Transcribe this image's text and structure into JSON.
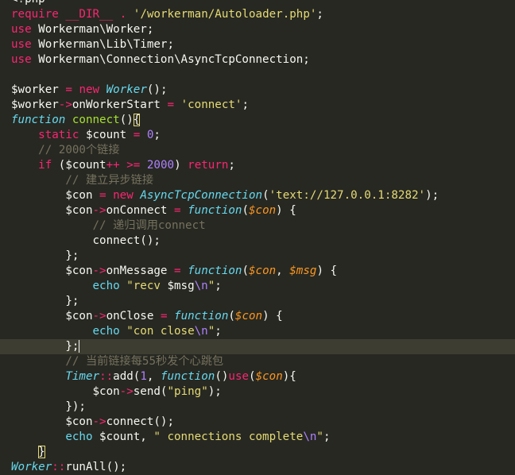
{
  "editor": {
    "theme": {
      "background": "#272822",
      "current_line": "#3e3d32",
      "keyword": "#f92672",
      "storage": "#66d9ef",
      "function_name": "#a6e22e",
      "string": "#e6db74",
      "number": "#ae81ff",
      "parameter": "#fd971f",
      "comment": "#75715e",
      "text": "#f8f8f2"
    },
    "highlighted_line": 23,
    "lines": [
      [
        [
          "text",
          "<?php"
        ]
      ],
      [
        [
          "kw",
          "require"
        ],
        [
          "text",
          " "
        ],
        [
          "kw",
          "__DIR__"
        ],
        [
          "text",
          " "
        ],
        [
          "kw",
          "."
        ],
        [
          "text",
          " "
        ],
        [
          "str",
          "'/workerman/Autoloader.php'"
        ],
        [
          "text",
          ";"
        ]
      ],
      [
        [
          "kw",
          "use"
        ],
        [
          "text",
          " Workerman\\Worker;"
        ]
      ],
      [
        [
          "kw",
          "use"
        ],
        [
          "text",
          " Workerman\\Lib\\Timer;"
        ]
      ],
      [
        [
          "kw",
          "use"
        ],
        [
          "text",
          " Workerman\\Connection\\AsyncTcpConnection;"
        ]
      ],
      [],
      [
        [
          "text",
          "$worker "
        ],
        [
          "kw",
          "="
        ],
        [
          "text",
          " "
        ],
        [
          "kw",
          "new"
        ],
        [
          "text",
          " "
        ],
        [
          "cls",
          "Worker"
        ],
        [
          "text",
          "();"
        ]
      ],
      [
        [
          "text",
          "$worker"
        ],
        [
          "kw",
          "->"
        ],
        [
          "text",
          "onWorkerStart "
        ],
        [
          "kw",
          "="
        ],
        [
          "text",
          " "
        ],
        [
          "str",
          "'connect'"
        ],
        [
          "text",
          ";"
        ]
      ],
      [
        [
          "storage",
          "function"
        ],
        [
          "text",
          " "
        ],
        [
          "fn",
          "connect"
        ],
        [
          "text",
          "()"
        ],
        [
          "match",
          "{"
        ]
      ],
      [
        [
          "text",
          "    "
        ],
        [
          "kw",
          "static"
        ],
        [
          "text",
          " $count "
        ],
        [
          "kw",
          "="
        ],
        [
          "text",
          " "
        ],
        [
          "num",
          "0"
        ],
        [
          "text",
          ";"
        ]
      ],
      [
        [
          "text",
          "    "
        ],
        [
          "comment",
          "// 2000个链接"
        ]
      ],
      [
        [
          "text",
          "    "
        ],
        [
          "kw",
          "if"
        ],
        [
          "text",
          " ($count"
        ],
        [
          "kw",
          "++"
        ],
        [
          "text",
          " "
        ],
        [
          "kw",
          ">="
        ],
        [
          "text",
          " "
        ],
        [
          "num",
          "2000"
        ],
        [
          "text",
          ") "
        ],
        [
          "kw",
          "return"
        ],
        [
          "text",
          ";"
        ]
      ],
      [
        [
          "text",
          "        "
        ],
        [
          "comment",
          "// 建立异步链接"
        ]
      ],
      [
        [
          "text",
          "        $con "
        ],
        [
          "kw",
          "="
        ],
        [
          "text",
          " "
        ],
        [
          "kw",
          "new"
        ],
        [
          "text",
          " "
        ],
        [
          "cls",
          "AsyncTcpConnection"
        ],
        [
          "text",
          "("
        ],
        [
          "str",
          "'text://127.0.0.1:8282'"
        ],
        [
          "text",
          ");"
        ]
      ],
      [
        [
          "text",
          "        $con"
        ],
        [
          "kw",
          "->"
        ],
        [
          "text",
          "onConnect "
        ],
        [
          "kw",
          "="
        ],
        [
          "text",
          " "
        ],
        [
          "storage",
          "function"
        ],
        [
          "text",
          "("
        ],
        [
          "param",
          "$con"
        ],
        [
          "text",
          ") {"
        ]
      ],
      [
        [
          "text",
          "            "
        ],
        [
          "comment",
          "// 递归调用connect"
        ]
      ],
      [
        [
          "text",
          "            connect();"
        ]
      ],
      [
        [
          "text",
          "        };"
        ]
      ],
      [
        [
          "text",
          "        $con"
        ],
        [
          "kw",
          "->"
        ],
        [
          "text",
          "onMessage "
        ],
        [
          "kw",
          "="
        ],
        [
          "text",
          " "
        ],
        [
          "storage",
          "function"
        ],
        [
          "text",
          "("
        ],
        [
          "param",
          "$con"
        ],
        [
          "text",
          ", "
        ],
        [
          "param",
          "$msg"
        ],
        [
          "text",
          ") {"
        ]
      ],
      [
        [
          "text",
          "            "
        ],
        [
          "builtin",
          "echo"
        ],
        [
          "text",
          " "
        ],
        [
          "str",
          "\"recv "
        ],
        [
          "text",
          "$msg"
        ],
        [
          "num",
          "\\n"
        ],
        [
          "str",
          "\""
        ],
        [
          "text",
          ";"
        ]
      ],
      [
        [
          "text",
          "        };"
        ]
      ],
      [
        [
          "text",
          "        $con"
        ],
        [
          "kw",
          "->"
        ],
        [
          "text",
          "onClose "
        ],
        [
          "kw",
          "="
        ],
        [
          "text",
          " "
        ],
        [
          "storage",
          "function"
        ],
        [
          "text",
          "("
        ],
        [
          "param",
          "$con"
        ],
        [
          "text",
          ") {"
        ]
      ],
      [
        [
          "text",
          "            "
        ],
        [
          "builtin",
          "echo"
        ],
        [
          "text",
          " "
        ],
        [
          "str",
          "\"con close"
        ],
        [
          "num",
          "\\n"
        ],
        [
          "str",
          "\""
        ],
        [
          "text",
          ";"
        ]
      ],
      [
        [
          "text",
          "        };"
        ],
        [
          "cursor",
          ""
        ]
      ],
      [
        [
          "text",
          "        "
        ],
        [
          "comment",
          "// 当前链接每55秒发个心跳包"
        ]
      ],
      [
        [
          "text",
          "        "
        ],
        [
          "cls",
          "Timer"
        ],
        [
          "kw",
          "::"
        ],
        [
          "text",
          "add("
        ],
        [
          "num",
          "1"
        ],
        [
          "text",
          ", "
        ],
        [
          "storage",
          "function"
        ],
        [
          "text",
          "()"
        ],
        [
          "kw",
          "use"
        ],
        [
          "text",
          "("
        ],
        [
          "param",
          "$con"
        ],
        [
          "text",
          "){"
        ]
      ],
      [
        [
          "text",
          "            $con"
        ],
        [
          "kw",
          "->"
        ],
        [
          "text",
          "send("
        ],
        [
          "str",
          "\"ping\""
        ],
        [
          "text",
          ");"
        ]
      ],
      [
        [
          "text",
          "        });"
        ]
      ],
      [
        [
          "text",
          "        $con"
        ],
        [
          "kw",
          "->"
        ],
        [
          "text",
          "connect();"
        ]
      ],
      [
        [
          "text",
          "        "
        ],
        [
          "builtin",
          "echo"
        ],
        [
          "text",
          " $count, "
        ],
        [
          "str",
          "\" connections complete"
        ],
        [
          "num",
          "\\n"
        ],
        [
          "str",
          "\""
        ],
        [
          "text",
          ";"
        ]
      ],
      [
        [
          "text",
          "    "
        ],
        [
          "match",
          "}"
        ]
      ],
      [
        [
          "cls",
          "Worker"
        ],
        [
          "kw",
          "::"
        ],
        [
          "text",
          "runAll();"
        ]
      ]
    ]
  }
}
